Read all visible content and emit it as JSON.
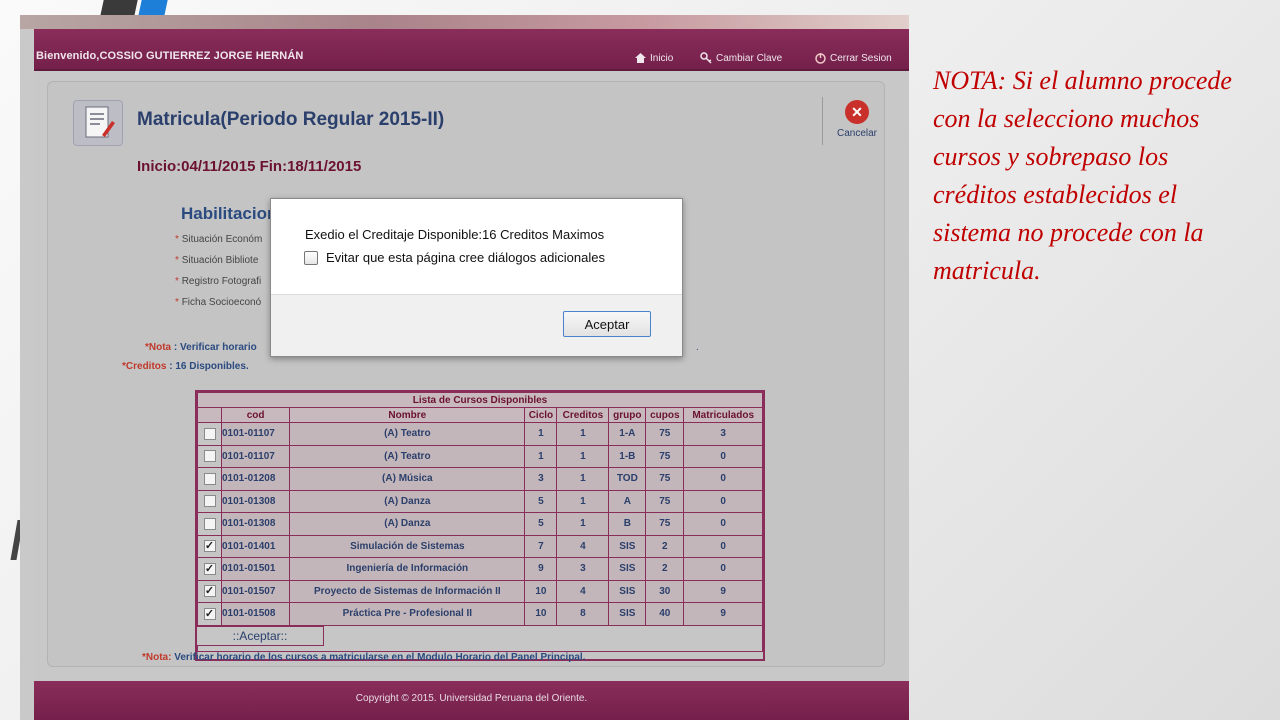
{
  "app": {
    "welcome": "Bienvenido,COSSIO GUTIERREZ JORGE HERNÁN",
    "nav": [
      {
        "label": "Inicio",
        "icon": "home-icon"
      },
      {
        "label": "Cambiar Clave",
        "icon": "key-icon"
      },
      {
        "label": "Cerrar Sesion",
        "icon": "power-icon"
      }
    ]
  },
  "page": {
    "title": "Matricula(Periodo Regular 2015-II)",
    "cancel_label": "Cancelar",
    "dates": "Inicio:04/11/2015 Fin:18/11/2015",
    "habilitaciones_title": "Habilitaciones",
    "habilitaciones": [
      "Situación Económ",
      "Situación Bibliote",
      "Registro Fotografi",
      "Ficha Socioeconó"
    ],
    "nota_label": "*Nota",
    "nota_text": " : Verificar horario",
    "trailing_dot": ".",
    "creditos_label": "*Creditos",
    "creditos_text": " : 16 Disponibles. "
  },
  "table": {
    "caption": "Lista de Cursos Disponibles",
    "headers": [
      "cod",
      "Nombre",
      "Ciclo",
      "Creditos",
      "grupo",
      "cupos",
      "Matriculados"
    ],
    "rows": [
      {
        "checked": false,
        "cod": "0101-01107",
        "nombre": "(A) Teatro",
        "ciclo": "1",
        "creditos": "1",
        "grupo": "1-A",
        "cupos": "75",
        "matriculados": "3"
      },
      {
        "checked": false,
        "cod": "0101-01107",
        "nombre": "(A) Teatro",
        "ciclo": "1",
        "creditos": "1",
        "grupo": "1-B",
        "cupos": "75",
        "matriculados": "0"
      },
      {
        "checked": false,
        "cod": "0101-01208",
        "nombre": "(A) Música",
        "ciclo": "3",
        "creditos": "1",
        "grupo": "TOD",
        "cupos": "75",
        "matriculados": "0"
      },
      {
        "checked": false,
        "cod": "0101-01308",
        "nombre": "(A) Danza",
        "ciclo": "5",
        "creditos": "1",
        "grupo": "A",
        "cupos": "75",
        "matriculados": "0"
      },
      {
        "checked": false,
        "cod": "0101-01308",
        "nombre": "(A) Danza",
        "ciclo": "5",
        "creditos": "1",
        "grupo": "B",
        "cupos": "75",
        "matriculados": "0"
      },
      {
        "checked": true,
        "cod": "0101-01401",
        "nombre": "Simulación de Sistemas",
        "ciclo": "7",
        "creditos": "4",
        "grupo": "SIS",
        "cupos": "2",
        "matriculados": "0"
      },
      {
        "checked": true,
        "cod": "0101-01501",
        "nombre": "Ingeniería de Información",
        "ciclo": "9",
        "creditos": "3",
        "grupo": "SIS",
        "cupos": "2",
        "matriculados": "0"
      },
      {
        "checked": true,
        "cod": "0101-01507",
        "nombre": "Proyecto de Sistemas de Información II",
        "ciclo": "10",
        "creditos": "4",
        "grupo": "SIS",
        "cupos": "30",
        "matriculados": "9"
      },
      {
        "checked": true,
        "cod": "0101-01508",
        "nombre": "Práctica Pre - Profesional II",
        "ciclo": "10",
        "creditos": "8",
        "grupo": "SIS",
        "cupos": "40",
        "matriculados": "9"
      }
    ],
    "accept_label": "::Aceptar::"
  },
  "bottom_note": {
    "label": "*Nota:",
    "text": " Verificar horario de los cursos a matricularse en el Modulo Horario del Panel Principal."
  },
  "footer": "Copyright © 2015. Universidad Peruana del Oriente.",
  "dialog": {
    "message": "Exedio el Creditaje Disponible:16 Creditos Maximos",
    "checkbox_label": "Evitar que esta página cree diálogos adicionales",
    "ok_label": "Aceptar"
  },
  "slide_note": "NOTA:  Si el alumno procede con la selecciono muchos cursos y sobrepaso los créditos establecidos el sistema no procede con la matricula.",
  "colors": {
    "brand": "#8a2d5a",
    "note_red": "#c00000"
  }
}
